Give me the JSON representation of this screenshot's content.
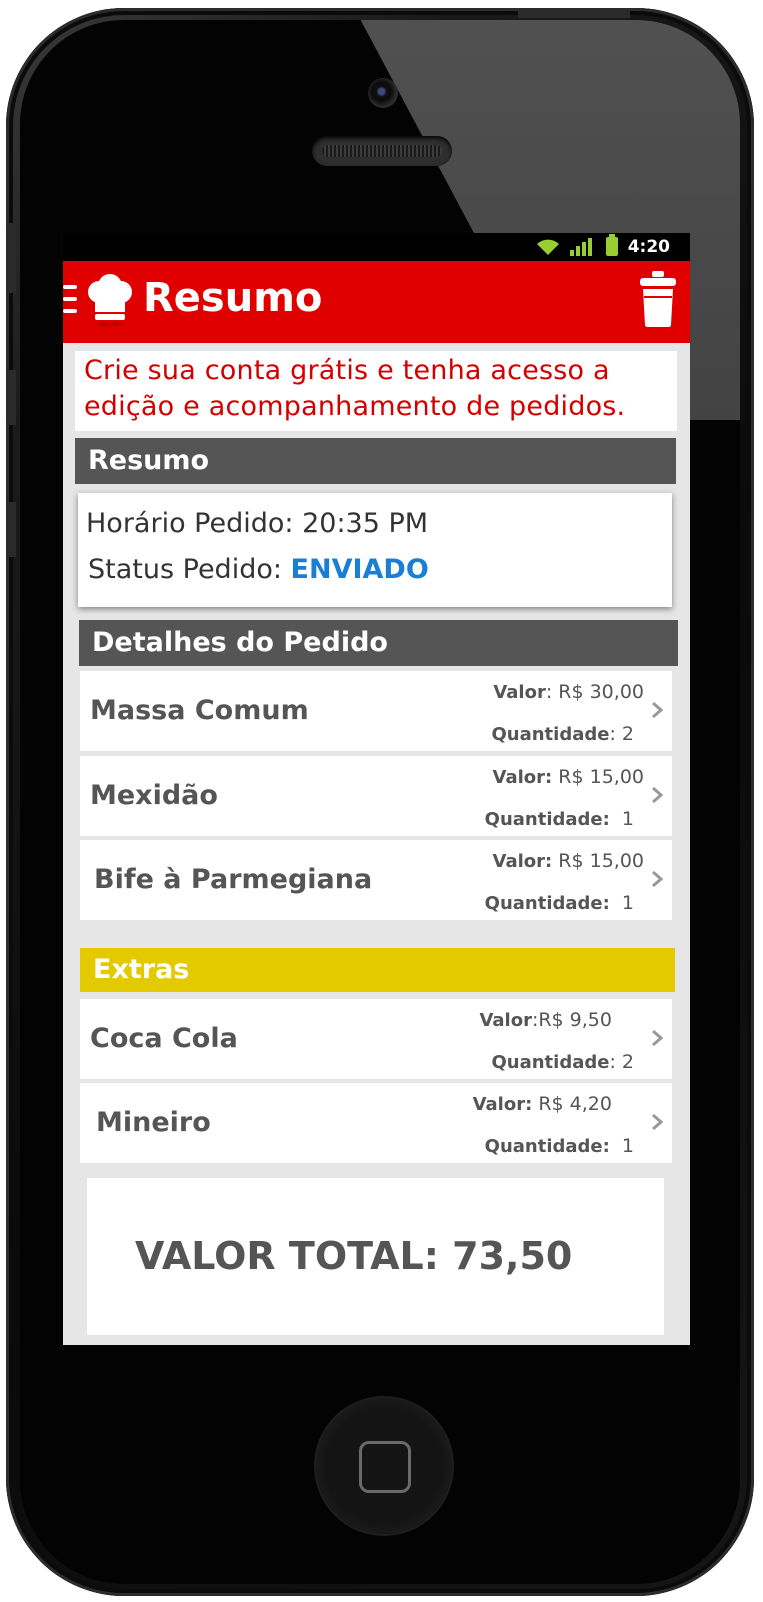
{
  "status_bar": {
    "time": "4:20"
  },
  "action_bar": {
    "title": "Resumo"
  },
  "promo": {
    "line1": "Crie sua conta grátis e tenha acesso a",
    "line2": "edição e acompanhamento de pedidos."
  },
  "summary": {
    "header": "Resumo",
    "time_label": "Horário Pedido:",
    "time_value": "20:35 PM",
    "status_label": "Status Pedido:",
    "status_value": "ENVIADO",
    "status_color": "#1a7fd4"
  },
  "details": {
    "header": "Detalhes do Pedido",
    "items": [
      {
        "name": "Massa Comum",
        "valor_label": "Valor",
        "valor": ": R$ 30,00",
        "qtd_label": "Quantidade",
        "qtd": ": 2"
      },
      {
        "name": "Mexidão",
        "valor_label": "Valor:",
        "valor": " R$ 15,00",
        "qtd_label": "Quantidade:",
        "qtd": "  1"
      },
      {
        "name": "Bife à Parmegiana",
        "valor_label": "Valor:",
        "valor": " R$ 15,00",
        "qtd_label": "Quantidade:",
        "qtd": "  1"
      }
    ]
  },
  "extras": {
    "header": "Extras",
    "items": [
      {
        "name": "Coca Cola",
        "valor_label": "Valor",
        "valor": ":R$ 9,50",
        "qtd_label": "Quantidade",
        "qtd": ": 2"
      },
      {
        "name": "Mineiro",
        "valor_label": "Valor:",
        "valor": " R$ 4,20",
        "qtd_label": "Quantidade:",
        "qtd": "  1"
      }
    ]
  },
  "total": {
    "text": "VALOR TOTAL: 73,50"
  },
  "colors": {
    "action_bar": "#e00000",
    "section_header": "#555555",
    "extras_header": "#e3c900",
    "promo_text": "#d40000"
  },
  "icons": [
    "menu-icon",
    "chef-hat-icon",
    "trash-icon",
    "wifi-icon",
    "signal-icon",
    "battery-icon",
    "chevron-right-icon"
  ]
}
